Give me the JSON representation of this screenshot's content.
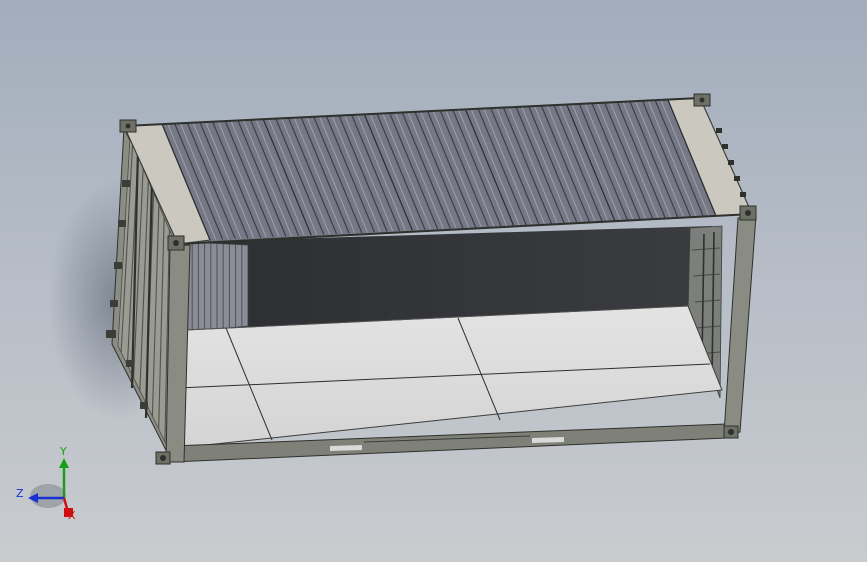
{
  "viewport": {
    "background_top": "#a2adbc",
    "background_bottom": "#c9cccf"
  },
  "model": {
    "frame_color": "#7f8178",
    "frame_dark": "#3b3d39",
    "roof_color": "#6e717c",
    "floor_color": "#dcdcdc",
    "interior_dark": "#303236",
    "roof_corrugations": 40,
    "side_ribs": 10
  },
  "triad": {
    "x_label": "X",
    "y_label": "Y",
    "z_label": "Z",
    "x_color": "#d01010",
    "y_color": "#18a018",
    "z_color": "#1a2fd0"
  }
}
